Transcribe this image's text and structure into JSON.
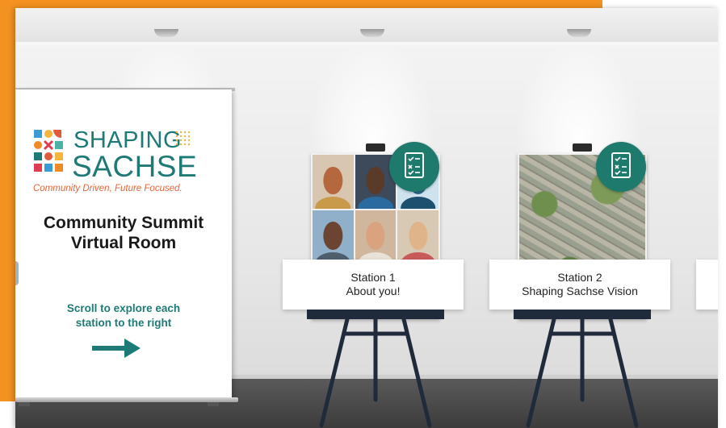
{
  "banner": {
    "logo_line1": "SHAPING",
    "logo_line2": "SACHSE",
    "tagline": "Community Driven, Future Focused.",
    "title_line1": "Community Summit",
    "title_line2": "Virtual Room",
    "scroll_line1": "Scroll to explore each",
    "scroll_line2": "station to the right"
  },
  "stations": [
    {
      "title": "Station 1",
      "subtitle": "About you!",
      "icon": "checklist-icon",
      "image": "participant-photos"
    },
    {
      "title": "Station 2",
      "subtitle": "Shaping Sachse Vision",
      "icon": "checklist-icon",
      "image": "aerial-neighborhood-photo"
    }
  ],
  "colors": {
    "accent_orange": "#f39121",
    "brand_teal": "#1e7a76",
    "tagline_orange": "#e2653a",
    "badge_teal": "#1e7a6c"
  }
}
